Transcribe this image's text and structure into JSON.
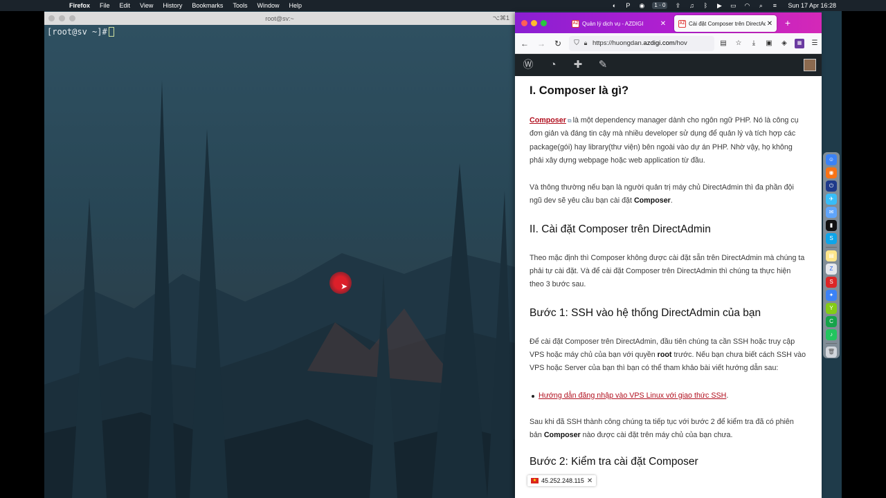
{
  "menubar": {
    "apple_icon": "apple-icon",
    "app_name": "Firefox",
    "items": [
      "File",
      "Edit",
      "View",
      "History",
      "Bookmarks",
      "Tools",
      "Window",
      "Help"
    ],
    "status_badge": "1 · 0",
    "clock": "Sun 17 Apr  16:28"
  },
  "terminal": {
    "title": "root@sv:~",
    "shortcut": "⌥⌘1",
    "prompt": "[root@sv ~]#"
  },
  "firefox": {
    "tabs": [
      {
        "label": "Quản lý dịch vụ - AZDIGI",
        "active": false
      },
      {
        "label": "Cài đặt Composer trên DirectAd",
        "active": true
      }
    ],
    "url_prefix": "https://huongdan.",
    "url_domain": "azdigi.com",
    "url_suffix": "/hov"
  },
  "article": {
    "h1": "I. Composer là gì?",
    "p1_link": "Composer",
    "p1_rest": "là một dependency manager dành cho ngôn ngữ PHP. Nó là công cụ đơn giản và đáng tin cậy mà nhiều developer sử dụng để quản lý và tích hợp các package(gói) hay library(thư viện) bên ngoài vào dự án PHP. Nhờ vậy, họ không phải xây dựng webpage hoặc web application từ đầu.",
    "p2_pre": "Và thông thường nếu bạn là người quản trị máy chủ DirectAdmin thì đa phần đội ngũ dev sẽ yêu cầu bạn cài đặt",
    "p2_bold": "Composer",
    "p2_post": ".",
    "h2_1": "II. Cài đặt Composer trên DirectAdmin",
    "p3": "Theo mặc định thì Composer không được cài đặt sẵn trên DirectAdmin mà chúng ta phải tự cài đặt. Và để cài đặt Composer trên DirectAdmin thì chúng ta thực hiện theo 3 bước sau.",
    "h2_2": "Bước 1: SSH vào hệ thống DirectAdmin của bạn",
    "p4_pre": "Để cài đặt Composer trên DirectAdmin, đầu tiên chúng ta cần SSH hoặc truy cập VPS hoặc máy chủ của bạn với quyền",
    "p4_bold": "root",
    "p4_post": "trước. Nếu bạn chưa biết cách SSH vào VPS hoặc Server của bạn thì bạn có thể tham khảo bài viết hướng dẫn sau:",
    "list_link": "Hướng dẫn đăng nhập vào VPS Linux với giao thức SSH",
    "list_post": ".",
    "p5_pre": "Sau khi đã SSH thành công chúng ta tiếp tục với bước 2 để kiểm tra đã có phiên bản",
    "p5_bold": "Composer",
    "p5_post": "nào được cài đặt trên máy chủ của bạn chưa.",
    "h2_3": "Bước 2: Kiểm tra cài đặt Composer"
  },
  "ip_badge": {
    "ip": "45.252.248.115"
  },
  "colors": {
    "tabbar_start": "#8a1fd2",
    "tabbar_end": "#d428b7",
    "wp_admin_bar": "#1d2327",
    "link": "#b10f1e",
    "terminal_bg": "#26424f"
  }
}
